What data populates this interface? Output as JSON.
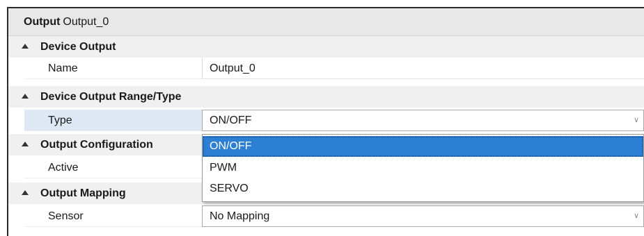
{
  "header": {
    "kind": "Output",
    "name": "Output_0"
  },
  "categories": [
    {
      "label": "Device Output"
    },
    {
      "label": "Device Output Range/Type"
    },
    {
      "label": "Output Configuration"
    },
    {
      "label": "Output Mapping"
    }
  ],
  "properties": {
    "name": {
      "label": "Name",
      "value": "Output_0"
    },
    "type": {
      "label": "Type",
      "value": "ON/OFF"
    },
    "active": {
      "label": "Active",
      "value": ""
    },
    "sensor": {
      "label": "Sensor",
      "value": "No Mapping"
    }
  },
  "dropdown": {
    "options": [
      "ON/OFF",
      "PWM",
      "SERVO"
    ],
    "selected": "ON/OFF"
  },
  "icons": {
    "collapse": "triangle-collapse-icon",
    "combo": "chevron-down-icon"
  },
  "colors": {
    "selection": "#2d7fd3",
    "selected_row": "#dde8f4",
    "header": "#e8e8e8"
  }
}
